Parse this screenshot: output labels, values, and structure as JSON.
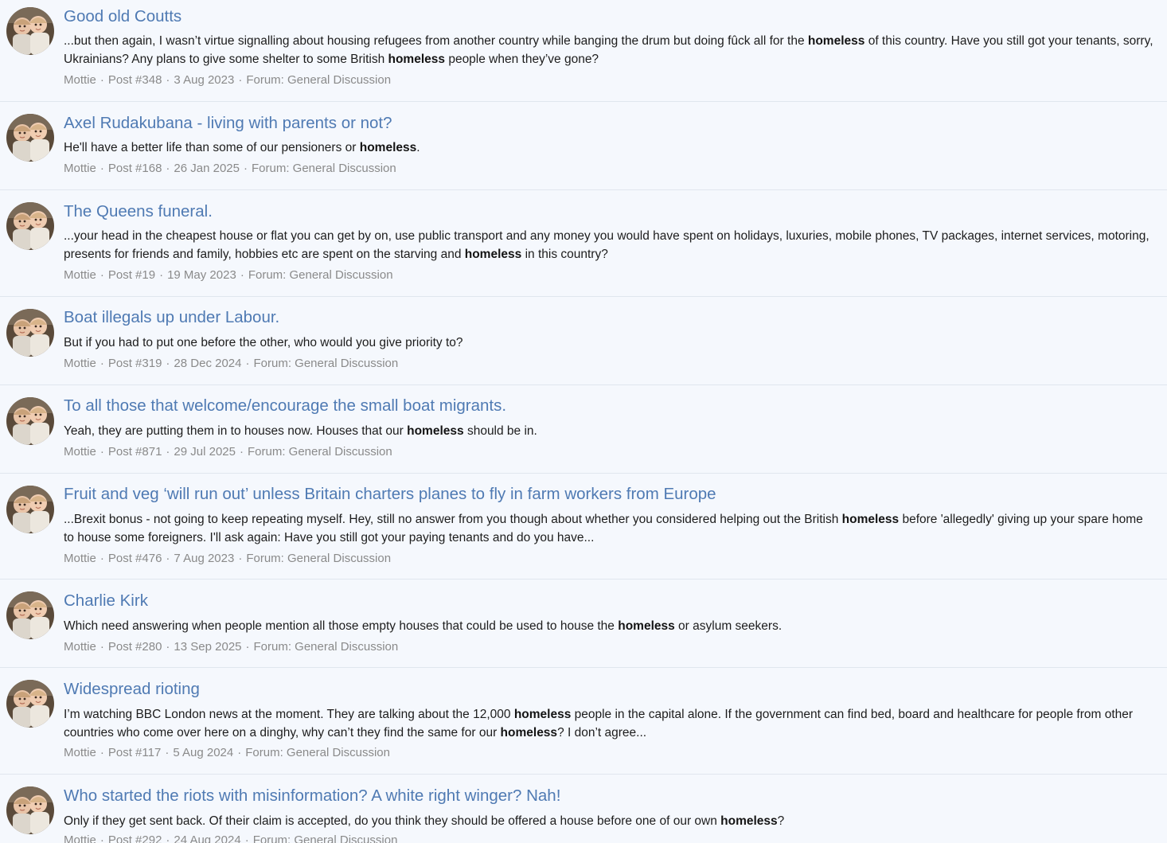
{
  "results": [
    {
      "title": "Good old Coutts",
      "snippet": [
        {
          "t": "...but then again, I wasn’t virtue signalling about housing refugees from another country while banging the drum but doing fûck all for the "
        },
        {
          "t": "homeless",
          "b": true
        },
        {
          "t": " of this country. Have you still got your tenants, sorry, Ukrainians? Any plans to give some shelter to some British "
        },
        {
          "t": "homeless",
          "b": true
        },
        {
          "t": " people when they’ve gone?"
        }
      ],
      "author": "Mottie",
      "post": "Post #348",
      "date": "3 Aug 2023",
      "forum": "Forum: General Discussion"
    },
    {
      "title": "Axel Rudakubana - living with parents or not?",
      "snippet": [
        {
          "t": "He'll have a better life than some of our pensioners or "
        },
        {
          "t": "homeless",
          "b": true
        },
        {
          "t": "."
        }
      ],
      "author": "Mottie",
      "post": "Post #168",
      "date": "26 Jan 2025",
      "forum": "Forum: General Discussion"
    },
    {
      "title": "The Queens funeral.",
      "snippet": [
        {
          "t": "...your head in the cheapest house or flat you can get by on, use public transport and any money you would have spent on holidays, luxuries, mobile phones, TV packages, internet services, motoring, presents for friends and family, hobbies etc are spent on the starving and "
        },
        {
          "t": "homeless",
          "b": true
        },
        {
          "t": " in this country?"
        }
      ],
      "author": "Mottie",
      "post": "Post #19",
      "date": "19 May 2023",
      "forum": "Forum: General Discussion"
    },
    {
      "title": "Boat illegals up under Labour.",
      "snippet": [
        {
          "t": "But if you had to put one before the other, who would you give priority to?"
        }
      ],
      "author": "Mottie",
      "post": "Post #319",
      "date": "28 Dec 2024",
      "forum": "Forum: General Discussion"
    },
    {
      "title": "To all those that welcome/encourage the small boat migrants.",
      "snippet": [
        {
          "t": "Yeah, they are putting them in to houses now. Houses that our "
        },
        {
          "t": "homeless",
          "b": true
        },
        {
          "t": " should be in."
        }
      ],
      "author": "Mottie",
      "post": "Post #871",
      "date": "29 Jul 2025",
      "forum": "Forum: General Discussion"
    },
    {
      "title": "Fruit and veg ‘will run out’ unless Britain charters planes to fly in farm workers from Europe",
      "snippet": [
        {
          "t": "...Brexit bonus - not going to keep repeating myself. Hey, still no answer from you though about whether you considered helping out the British "
        },
        {
          "t": "homeless",
          "b": true
        },
        {
          "t": " before 'allegedly' giving up your spare home to house some foreigners. I'll ask again: Have you still got your paying tenants and do you have..."
        }
      ],
      "author": "Mottie",
      "post": "Post #476",
      "date": "7 Aug 2023",
      "forum": "Forum: General Discussion"
    },
    {
      "title": "Charlie Kirk",
      "snippet": [
        {
          "t": "Which need answering when people mention all those empty houses that could be used to house the "
        },
        {
          "t": "homeless",
          "b": true
        },
        {
          "t": " or asylum seekers."
        }
      ],
      "author": "Mottie",
      "post": "Post #280",
      "date": "13 Sep 2025",
      "forum": "Forum: General Discussion"
    },
    {
      "title": "Widespread rioting",
      "snippet": [
        {
          "t": "I’m watching BBC London news at the moment. They are talking about the 12,000 "
        },
        {
          "t": "homeless",
          "b": true
        },
        {
          "t": " people in the capital alone. If the government can find bed, board and healthcare for people from other countries who come over here on a dinghy, why can’t they find the same for our "
        },
        {
          "t": "homeless",
          "b": true
        },
        {
          "t": "? I don’t agree..."
        }
      ],
      "author": "Mottie",
      "post": "Post #117",
      "date": "5 Aug 2024",
      "forum": "Forum: General Discussion"
    },
    {
      "title": "Who started the riots with misinformation? A white right winger? Nah!",
      "snippet": [
        {
          "t": "Only if they get sent back. Of their claim is accepted, do you think they should be offered a house before one of our own "
        },
        {
          "t": "homeless",
          "b": true
        },
        {
          "t": "?"
        }
      ],
      "author": "Mottie",
      "post": "Post #292",
      "date": "24 Aug 2024",
      "forum": "Forum: General Discussion"
    }
  ]
}
